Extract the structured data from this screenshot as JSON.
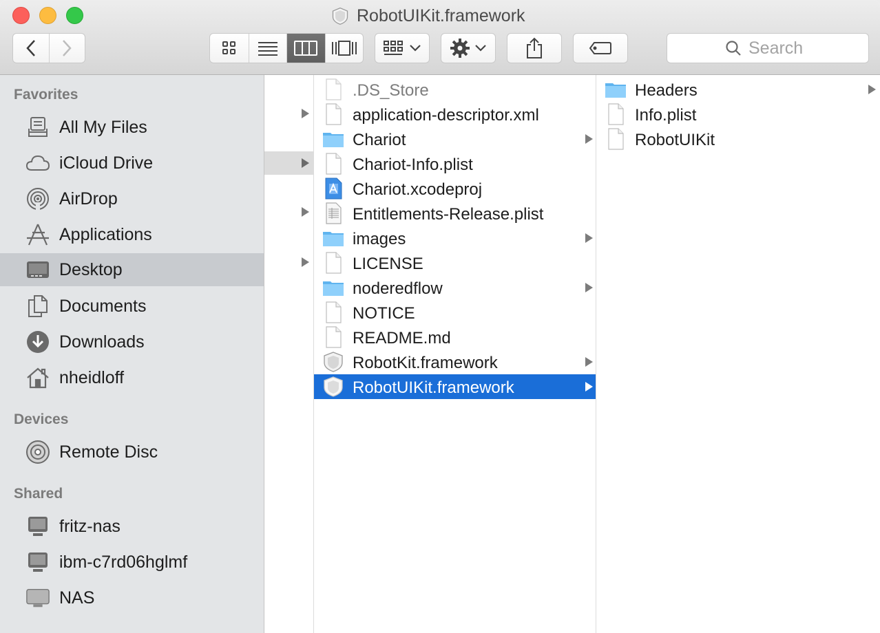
{
  "window": {
    "title": "RobotUIKit.framework"
  },
  "toolbar": {
    "search_placeholder": "Search"
  },
  "sidebar": {
    "favorites_label": "Favorites",
    "devices_label": "Devices",
    "shared_label": "Shared",
    "favorites": [
      {
        "label": "All My Files",
        "icon": "all-files-icon"
      },
      {
        "label": "iCloud Drive",
        "icon": "cloud-icon"
      },
      {
        "label": "AirDrop",
        "icon": "airdrop-icon"
      },
      {
        "label": "Applications",
        "icon": "applications-icon"
      },
      {
        "label": "Desktop",
        "icon": "desktop-icon",
        "selected": true
      },
      {
        "label": "Documents",
        "icon": "documents-icon"
      },
      {
        "label": "Downloads",
        "icon": "downloads-icon"
      },
      {
        "label": "nheidloff",
        "icon": "home-icon"
      }
    ],
    "devices": [
      {
        "label": "Remote Disc",
        "icon": "disc-icon"
      }
    ],
    "shared": [
      {
        "label": "fritz-nas",
        "icon": "monitor-icon"
      },
      {
        "label": "ibm-c7rd06hglmf",
        "icon": "monitor-icon"
      },
      {
        "label": "NAS",
        "icon": "monitor-icon"
      }
    ]
  },
  "column1": [
    {
      "label": ".DS_Store",
      "icon": "document-icon",
      "dim": true
    },
    {
      "label": "application-descriptor.xml",
      "icon": "document-icon"
    },
    {
      "label": "Chariot",
      "icon": "folder-icon",
      "arrow": true
    },
    {
      "label": "Chariot-Info.plist",
      "icon": "document-icon"
    },
    {
      "label": "Chariot.xcodeproj",
      "icon": "xcode-project-icon"
    },
    {
      "label": "Entitlements-Release.plist",
      "icon": "plist-icon"
    },
    {
      "label": "images",
      "icon": "folder-icon",
      "arrow": true
    },
    {
      "label": "LICENSE",
      "icon": "document-icon"
    },
    {
      "label": "noderedflow",
      "icon": "folder-icon",
      "arrow": true
    },
    {
      "label": "NOTICE",
      "icon": "document-icon"
    },
    {
      "label": "README.md",
      "icon": "document-icon"
    },
    {
      "label": "RobotKit.framework",
      "icon": "framework-icon",
      "arrow": true
    },
    {
      "label": "RobotUIKit.framework",
      "icon": "framework-icon",
      "arrow": true,
      "selected": true
    }
  ],
  "column2": [
    {
      "label": "Headers",
      "icon": "folder-icon",
      "arrow": true
    },
    {
      "label": "Info.plist",
      "icon": "document-icon"
    },
    {
      "label": "RobotUIKit",
      "icon": "document-icon"
    }
  ]
}
